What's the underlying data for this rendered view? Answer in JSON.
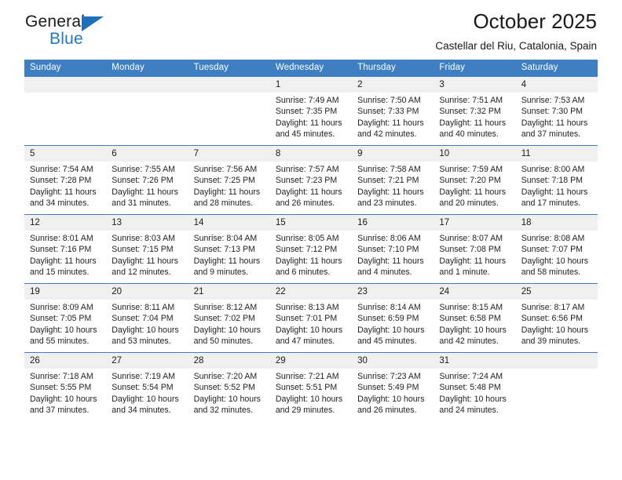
{
  "brand": {
    "name_dark": "General",
    "name_blue": "Blue",
    "triangle_color": "#1d6fb8",
    "blue_text_color": "#1d7ac4"
  },
  "header": {
    "title": "October 2025",
    "subtitle": "Castellar del Riu, Catalonia, Spain"
  },
  "theme": {
    "header_row_bg": "#3d7fc1",
    "header_row_text": "#ffffff",
    "daynum_bg": "#f0f0f0",
    "grid_line": "#3d7fc1"
  },
  "weekdays": [
    "Sunday",
    "Monday",
    "Tuesday",
    "Wednesday",
    "Thursday",
    "Friday",
    "Saturday"
  ],
  "labels": {
    "sunrise_prefix": "Sunrise:",
    "sunset_prefix": "Sunset:",
    "daylight_prefix": "Daylight:"
  },
  "weeks": [
    [
      {
        "empty": true
      },
      {
        "empty": true
      },
      {
        "empty": true
      },
      {
        "day": "1",
        "sunrise": "Sunrise: 7:49 AM",
        "sunset": "Sunset: 7:35 PM",
        "daylight_l1": "Daylight: 11 hours",
        "daylight_l2": "and 45 minutes."
      },
      {
        "day": "2",
        "sunrise": "Sunrise: 7:50 AM",
        "sunset": "Sunset: 7:33 PM",
        "daylight_l1": "Daylight: 11 hours",
        "daylight_l2": "and 42 minutes."
      },
      {
        "day": "3",
        "sunrise": "Sunrise: 7:51 AM",
        "sunset": "Sunset: 7:32 PM",
        "daylight_l1": "Daylight: 11 hours",
        "daylight_l2": "and 40 minutes."
      },
      {
        "day": "4",
        "sunrise": "Sunrise: 7:53 AM",
        "sunset": "Sunset: 7:30 PM",
        "daylight_l1": "Daylight: 11 hours",
        "daylight_l2": "and 37 minutes."
      }
    ],
    [
      {
        "day": "5",
        "sunrise": "Sunrise: 7:54 AM",
        "sunset": "Sunset: 7:28 PM",
        "daylight_l1": "Daylight: 11 hours",
        "daylight_l2": "and 34 minutes."
      },
      {
        "day": "6",
        "sunrise": "Sunrise: 7:55 AM",
        "sunset": "Sunset: 7:26 PM",
        "daylight_l1": "Daylight: 11 hours",
        "daylight_l2": "and 31 minutes."
      },
      {
        "day": "7",
        "sunrise": "Sunrise: 7:56 AM",
        "sunset": "Sunset: 7:25 PM",
        "daylight_l1": "Daylight: 11 hours",
        "daylight_l2": "and 28 minutes."
      },
      {
        "day": "8",
        "sunrise": "Sunrise: 7:57 AM",
        "sunset": "Sunset: 7:23 PM",
        "daylight_l1": "Daylight: 11 hours",
        "daylight_l2": "and 26 minutes."
      },
      {
        "day": "9",
        "sunrise": "Sunrise: 7:58 AM",
        "sunset": "Sunset: 7:21 PM",
        "daylight_l1": "Daylight: 11 hours",
        "daylight_l2": "and 23 minutes."
      },
      {
        "day": "10",
        "sunrise": "Sunrise: 7:59 AM",
        "sunset": "Sunset: 7:20 PM",
        "daylight_l1": "Daylight: 11 hours",
        "daylight_l2": "and 20 minutes."
      },
      {
        "day": "11",
        "sunrise": "Sunrise: 8:00 AM",
        "sunset": "Sunset: 7:18 PM",
        "daylight_l1": "Daylight: 11 hours",
        "daylight_l2": "and 17 minutes."
      }
    ],
    [
      {
        "day": "12",
        "sunrise": "Sunrise: 8:01 AM",
        "sunset": "Sunset: 7:16 PM",
        "daylight_l1": "Daylight: 11 hours",
        "daylight_l2": "and 15 minutes."
      },
      {
        "day": "13",
        "sunrise": "Sunrise: 8:03 AM",
        "sunset": "Sunset: 7:15 PM",
        "daylight_l1": "Daylight: 11 hours",
        "daylight_l2": "and 12 minutes."
      },
      {
        "day": "14",
        "sunrise": "Sunrise: 8:04 AM",
        "sunset": "Sunset: 7:13 PM",
        "daylight_l1": "Daylight: 11 hours",
        "daylight_l2": "and 9 minutes."
      },
      {
        "day": "15",
        "sunrise": "Sunrise: 8:05 AM",
        "sunset": "Sunset: 7:12 PM",
        "daylight_l1": "Daylight: 11 hours",
        "daylight_l2": "and 6 minutes."
      },
      {
        "day": "16",
        "sunrise": "Sunrise: 8:06 AM",
        "sunset": "Sunset: 7:10 PM",
        "daylight_l1": "Daylight: 11 hours",
        "daylight_l2": "and 4 minutes."
      },
      {
        "day": "17",
        "sunrise": "Sunrise: 8:07 AM",
        "sunset": "Sunset: 7:08 PM",
        "daylight_l1": "Daylight: 11 hours",
        "daylight_l2": "and 1 minute."
      },
      {
        "day": "18",
        "sunrise": "Sunrise: 8:08 AM",
        "sunset": "Sunset: 7:07 PM",
        "daylight_l1": "Daylight: 10 hours",
        "daylight_l2": "and 58 minutes."
      }
    ],
    [
      {
        "day": "19",
        "sunrise": "Sunrise: 8:09 AM",
        "sunset": "Sunset: 7:05 PM",
        "daylight_l1": "Daylight: 10 hours",
        "daylight_l2": "and 55 minutes."
      },
      {
        "day": "20",
        "sunrise": "Sunrise: 8:11 AM",
        "sunset": "Sunset: 7:04 PM",
        "daylight_l1": "Daylight: 10 hours",
        "daylight_l2": "and 53 minutes."
      },
      {
        "day": "21",
        "sunrise": "Sunrise: 8:12 AM",
        "sunset": "Sunset: 7:02 PM",
        "daylight_l1": "Daylight: 10 hours",
        "daylight_l2": "and 50 minutes."
      },
      {
        "day": "22",
        "sunrise": "Sunrise: 8:13 AM",
        "sunset": "Sunset: 7:01 PM",
        "daylight_l1": "Daylight: 10 hours",
        "daylight_l2": "and 47 minutes."
      },
      {
        "day": "23",
        "sunrise": "Sunrise: 8:14 AM",
        "sunset": "Sunset: 6:59 PM",
        "daylight_l1": "Daylight: 10 hours",
        "daylight_l2": "and 45 minutes."
      },
      {
        "day": "24",
        "sunrise": "Sunrise: 8:15 AM",
        "sunset": "Sunset: 6:58 PM",
        "daylight_l1": "Daylight: 10 hours",
        "daylight_l2": "and 42 minutes."
      },
      {
        "day": "25",
        "sunrise": "Sunrise: 8:17 AM",
        "sunset": "Sunset: 6:56 PM",
        "daylight_l1": "Daylight: 10 hours",
        "daylight_l2": "and 39 minutes."
      }
    ],
    [
      {
        "day": "26",
        "sunrise": "Sunrise: 7:18 AM",
        "sunset": "Sunset: 5:55 PM",
        "daylight_l1": "Daylight: 10 hours",
        "daylight_l2": "and 37 minutes."
      },
      {
        "day": "27",
        "sunrise": "Sunrise: 7:19 AM",
        "sunset": "Sunset: 5:54 PM",
        "daylight_l1": "Daylight: 10 hours",
        "daylight_l2": "and 34 minutes."
      },
      {
        "day": "28",
        "sunrise": "Sunrise: 7:20 AM",
        "sunset": "Sunset: 5:52 PM",
        "daylight_l1": "Daylight: 10 hours",
        "daylight_l2": "and 32 minutes."
      },
      {
        "day": "29",
        "sunrise": "Sunrise: 7:21 AM",
        "sunset": "Sunset: 5:51 PM",
        "daylight_l1": "Daylight: 10 hours",
        "daylight_l2": "and 29 minutes."
      },
      {
        "day": "30",
        "sunrise": "Sunrise: 7:23 AM",
        "sunset": "Sunset: 5:49 PM",
        "daylight_l1": "Daylight: 10 hours",
        "daylight_l2": "and 26 minutes."
      },
      {
        "day": "31",
        "sunrise": "Sunrise: 7:24 AM",
        "sunset": "Sunset: 5:48 PM",
        "daylight_l1": "Daylight: 10 hours",
        "daylight_l2": "and 24 minutes."
      },
      {
        "empty": true
      }
    ]
  ]
}
